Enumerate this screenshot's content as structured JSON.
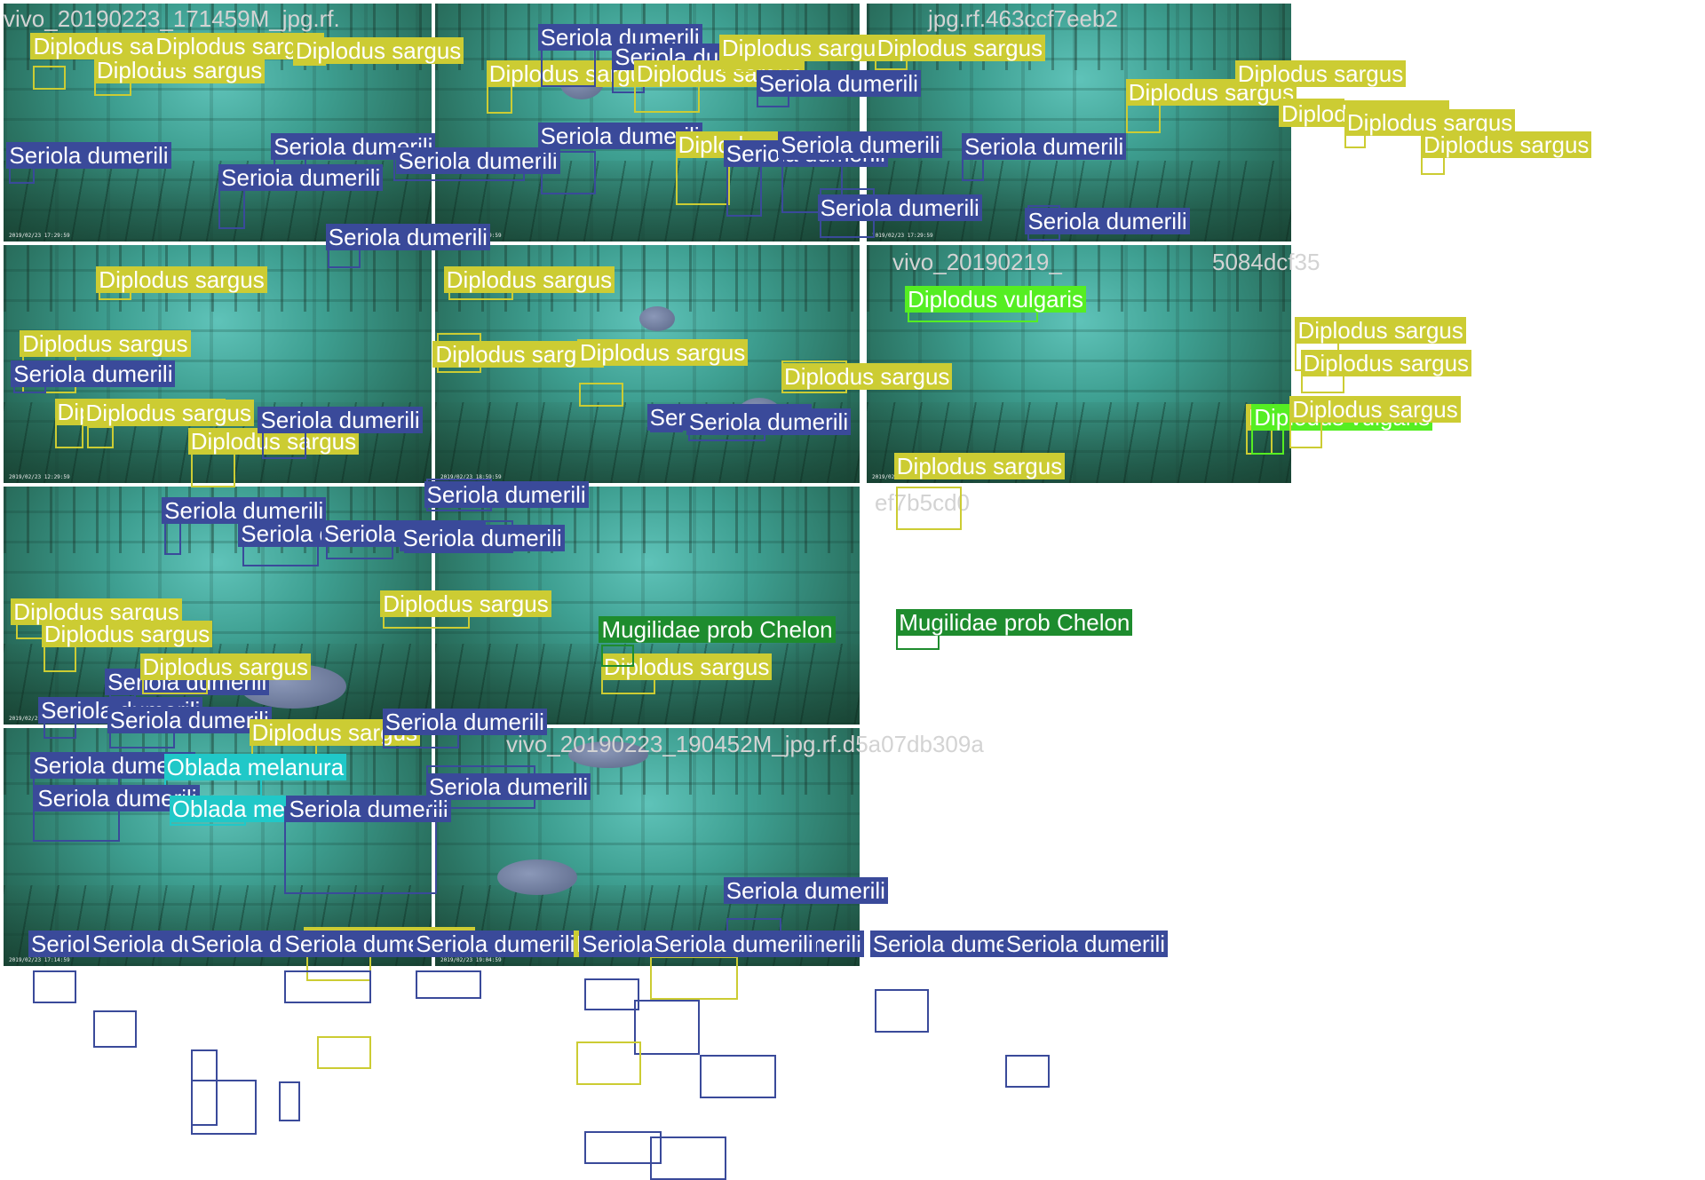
{
  "mosaic": {
    "title_overlays": [
      "vivo_20190223_171459M_jpg.rf.",
      "jpg.rf.463ccf7eeb2",
      "vivo_20190219_",
      "5084dcf35",
      "ef7b5cd0",
      "vivo_20190223_190452M_jpg.rf.d5a07db309a"
    ],
    "tiles": [
      {
        "timestamp": "2019/02/23 17:29:59"
      },
      {
        "timestamp": "2019/02/23 17:29:59"
      },
      {
        "timestamp": "2019/02/23 17:29:59"
      },
      {
        "timestamp": "2019/02/23 12:29:59"
      },
      {
        "timestamp": "2019/02/23 18:59:59"
      },
      {
        "timestamp": "2019/02/19 05:59:59"
      },
      {
        "timestamp": "2019/02/23 12:29:59"
      },
      {
        "timestamp": "2019/02/23 10:24:59"
      },
      {
        "timestamp": "2019/02/23 17:14:59"
      },
      {
        "timestamp": "2019/02/23 19:04:59"
      }
    ]
  },
  "classes": {
    "sargus": {
      "name": "Diplodus sargus",
      "color": "#cccc33"
    },
    "seriola": {
      "name": "Seriola dumerili",
      "color": "#3a4a9a"
    },
    "vulgaris": {
      "name": "Diplodus vulgaris",
      "color": "#55ee22"
    },
    "mugil": {
      "name": "Mugilidae prob Chelon",
      "color": "#1e8c2e"
    },
    "oblada": {
      "name": "Oblada melanura",
      "color": "#20c8c8"
    }
  }
}
